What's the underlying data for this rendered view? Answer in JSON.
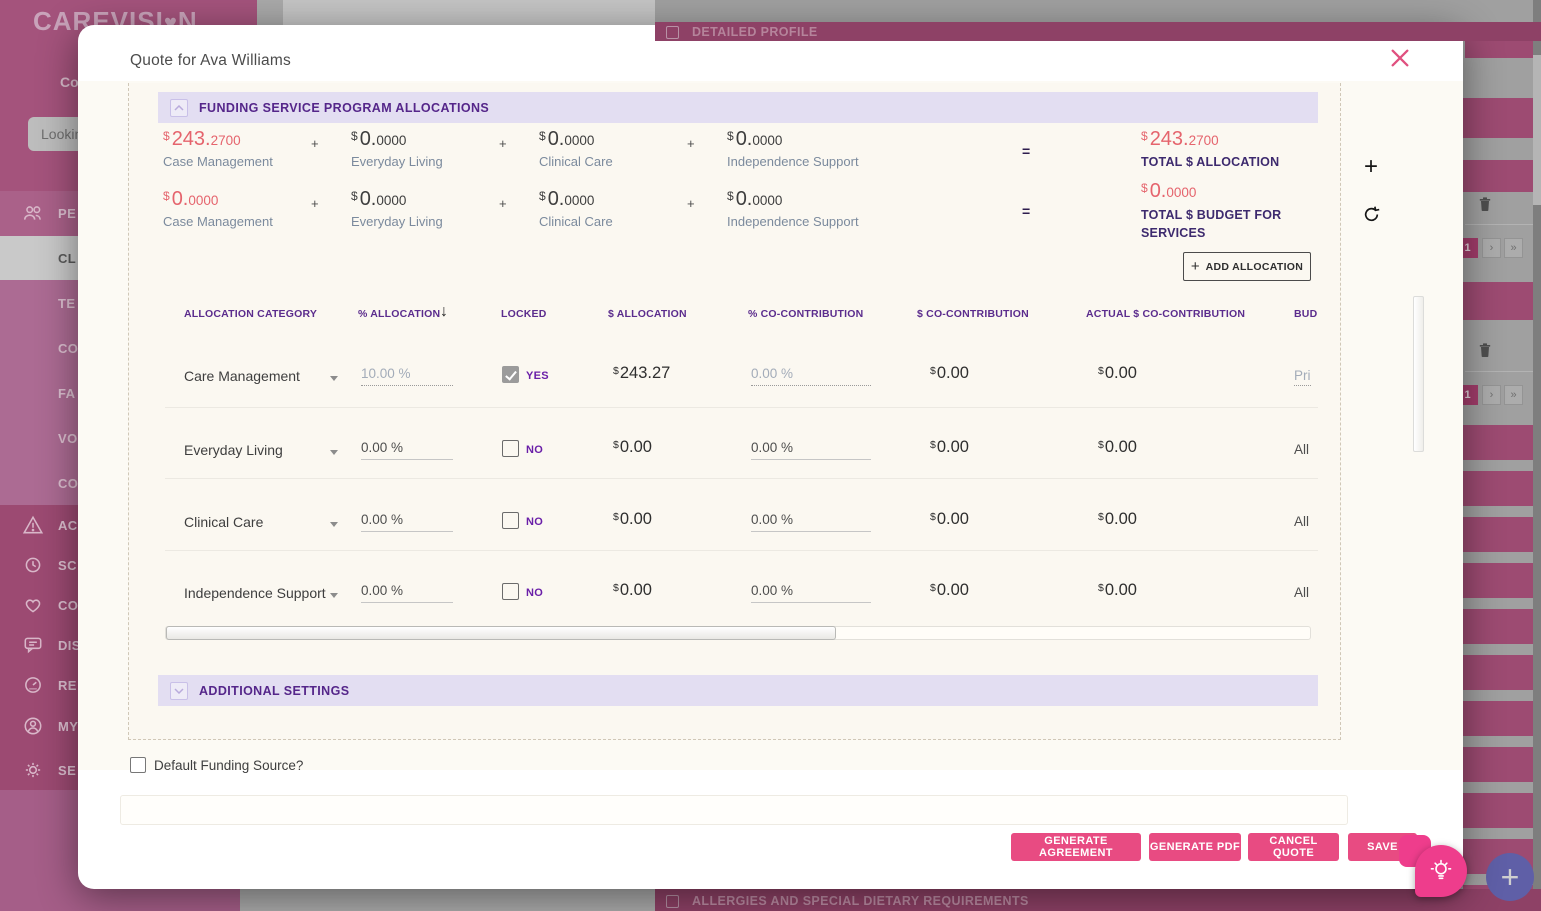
{
  "colors": {
    "brand_pink": "#E84B82",
    "money_red": "#E5646D",
    "heading_purple": "#55268A",
    "lavender": "#E3DEF2",
    "sidebar_pink": "#A4537C"
  },
  "background": {
    "logo": {
      "text": "CAREVISI",
      "heart": "♥",
      "suffix": "N"
    },
    "header_label": "Co",
    "search_text": "Lookin",
    "top_bar_label": "DETAILED PROFILE",
    "bottom_bar_label": "ALLERGIES AND SPECIAL DIETARY REQUIREMENTS",
    "menu_top": [
      {
        "label": "PE",
        "icon": "people"
      },
      {
        "label": "CL",
        "icon": "none"
      },
      {
        "label": "TE",
        "icon": "none"
      },
      {
        "label": "CO",
        "icon": "none"
      },
      {
        "label": "FA",
        "icon": "none"
      },
      {
        "label": "VO",
        "icon": "none"
      },
      {
        "label": "CO",
        "icon": "none"
      }
    ],
    "menu_bottom": [
      {
        "label": "AC",
        "icon": "alert-triangle"
      },
      {
        "label": "SC",
        "icon": "clock"
      },
      {
        "label": "CO",
        "icon": "heart"
      },
      {
        "label": "DIS",
        "icon": "chat"
      },
      {
        "label": "RE",
        "icon": "meter"
      },
      {
        "label": "MY",
        "icon": "person"
      },
      {
        "label": "SE",
        "icon": "gear"
      }
    ],
    "pagination": {
      "page": "1",
      "next": "›",
      "last": "»"
    }
  },
  "icons": {
    "close": "×",
    "sort_desc": "↓",
    "add": "+",
    "fab_plus": "+"
  },
  "modal": {
    "title": "Quote for Ava Williams",
    "currency": "$",
    "sections": {
      "funding": "FUNDING SERVICE PROGRAM ALLOCATIONS",
      "additional": "ADDITIONAL SETTINGS"
    },
    "summary": {
      "op": "+",
      "eq": "=",
      "row1": {
        "items": [
          {
            "int": "243.",
            "dec": "2700",
            "label": "Case Management"
          },
          {
            "int": "0.",
            "dec": "0000",
            "label": "Everyday Living"
          },
          {
            "int": "0.",
            "dec": "0000",
            "label": "Clinical Care"
          },
          {
            "int": "0.",
            "dec": "0000",
            "label": "Independence Support"
          }
        ],
        "total": {
          "int": "243.",
          "dec": "2700",
          "label": "TOTAL $ ALLOCATION"
        }
      },
      "row2": {
        "items": [
          {
            "int": "0.",
            "dec": "0000",
            "label": "Case Management"
          },
          {
            "int": "0.",
            "dec": "0000",
            "label": "Everyday Living"
          },
          {
            "int": "0.",
            "dec": "0000",
            "label": "Clinical Care"
          },
          {
            "int": "0.",
            "dec": "0000",
            "label": "Independence Support"
          }
        ],
        "total": {
          "int": "0.",
          "dec": "0000",
          "label": "TOTAL $ BUDGET FOR SERVICES"
        }
      }
    },
    "add_allocation_label": "ADD ALLOCATION",
    "table": {
      "headers": [
        "ALLOCATION CATEGORY",
        "% ALLOCATION",
        "LOCKED",
        "$ ALLOCATION",
        "% CO-CONTRIBUTION",
        "$ CO-CONTRIBUTION",
        "ACTUAL $ CO-CONTRIBUTION",
        "BUD"
      ],
      "rows": [
        {
          "category": "Care Management",
          "pct": "10.00 %",
          "locked": true,
          "locked_label": "YES",
          "alloc": "243.27",
          "co_pct": "0.00 %",
          "co": "0.00",
          "actual": "0.00",
          "budget": "Pri"
        },
        {
          "category": "Everyday Living",
          "pct": "0.00 %",
          "locked": false,
          "locked_label": "NO",
          "alloc": "0.00",
          "co_pct": "0.00 %",
          "co": "0.00",
          "actual": "0.00",
          "budget": "All"
        },
        {
          "category": "Clinical Care",
          "pct": "0.00 %",
          "locked": false,
          "locked_label": "NO",
          "alloc": "0.00",
          "co_pct": "0.00 %",
          "co": "0.00",
          "actual": "0.00",
          "budget": "All"
        },
        {
          "category": "Independence Support",
          "pct": "0.00 %",
          "locked": false,
          "locked_label": "NO",
          "alloc": "0.00",
          "co_pct": "0.00 %",
          "co": "0.00",
          "actual": "0.00",
          "budget": "All"
        }
      ]
    },
    "default_funding_label": "Default Funding Source?",
    "footer_buttons": {
      "agreement": "GENERATE AGREEMENT",
      "pdf": "GENERATE PDF",
      "cancel": "CANCEL QUOTE",
      "save": "SAVE"
    }
  }
}
